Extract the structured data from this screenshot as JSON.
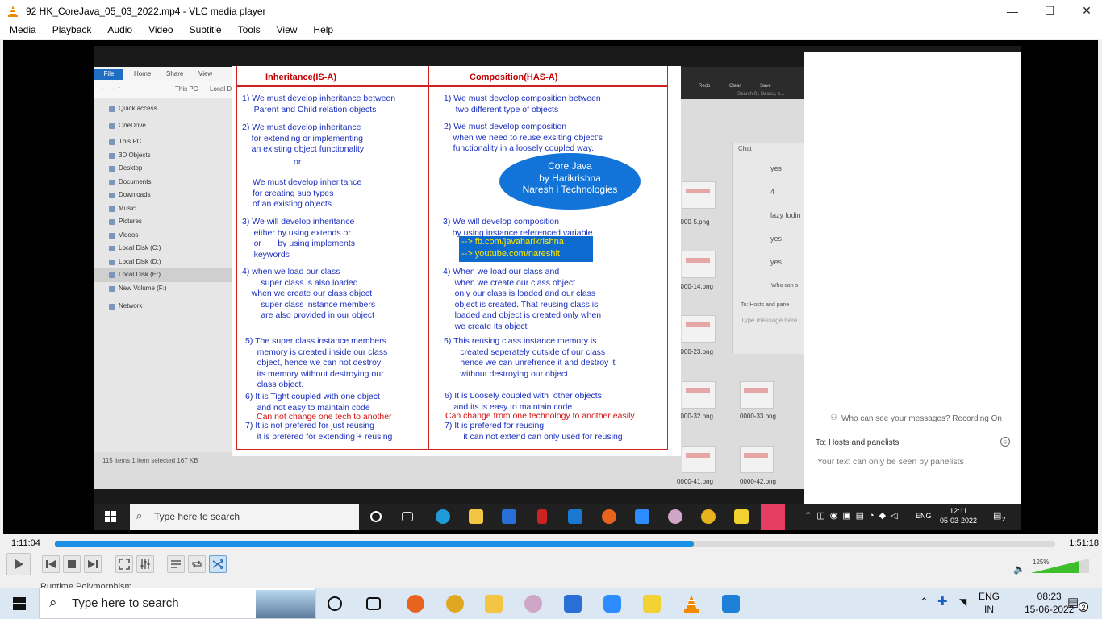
{
  "window": {
    "title": "92 HK_CoreJava_05_03_2022.mp4 - VLC media player",
    "minimize": "—",
    "maximize": "☐",
    "close": "✕"
  },
  "menu": [
    "Media",
    "Playback",
    "Audio",
    "Video",
    "Subtitle",
    "Tools",
    "View",
    "Help"
  ],
  "explorer": {
    "ribbon_tabs": [
      "File",
      "Home",
      "Share",
      "View"
    ],
    "path": [
      "This PC",
      "Local Di"
    ],
    "sidebar": [
      "Quick access",
      "OneDrive",
      "This PC",
      "3D Objects",
      "Desktop",
      "Documents",
      "Downloads",
      "Music",
      "Pictures",
      "Videos",
      "Local Disk (C:)",
      "Local Disk (D:)",
      "Local Disk (E:)",
      "New Volume (F:)",
      "Network"
    ],
    "status": "115 items    1 item selected  167 KB",
    "thumb_labels": [
      "0000-5.png",
      "0000-14.png",
      "0000-23.png",
      "0000-32.png",
      "0000-33.png",
      "0000-41.png",
      "0000-42.png"
    ],
    "search_placeholder": "Search 01 Basics, e...",
    "toolbar": [
      "Redo",
      "Clear",
      "Save"
    ]
  },
  "zoom_inner_chat": {
    "title": "Chat",
    "messages": [
      "yes",
      "4",
      "lazy lodin",
      "yes",
      "yes"
    ],
    "who": "Who can s",
    "to": "To:   Hosts and pane",
    "placeholder": "Type message here"
  },
  "slide": {
    "left_header": "Inheritance(IS-A)",
    "right_header": "Composition(HAS-A)",
    "left_points": [
      "1) We must develop inheritance between\n     Parent and Child relation objects",
      "2) We must develop inheritance\n    for extending or implementing\n    an existing object functionality",
      "or",
      "We must develop inheritance\nfor creating sub types\nof an existing objects.",
      "3) We will develop inheritance\n     either by using extends or\n     or       by using implements\n     keywords",
      "4) when we load our class\n        super class is also loaded\n    when we create our class object\n        super class instance members\n        are also provided in our object",
      "5) The super class instance members\n     memory is created inside our class\n     object, hence we can not destroy\n     its memory without destroying our\n     class object.",
      "6) It is Tight coupled with one object\n     and not easy to maintain code",
      "Can not change one tech to another",
      "7) It is not prefered for just reusing\n     it is prefered for extending + reusing"
    ],
    "right_points": [
      "1) We must develop composition between\n     two different type of objects",
      "2) We must develop composition\n    when we need to reuse exsiting object's\n    functionality in a loosely coupled way.",
      "3) We will develop composition\n    by using instance referenced variable",
      "4) When we load our class and\n     when we create our class object\n     only our class is loaded and our class\n     object is created. That reusing class is\n     loaded and object is created only when\n     we create its object",
      "5) This reusing class instance memory is\n       created seperately outside of our class\n       hence we can unrefrence it and destroy it\n       without destroying our object",
      "6) It is Loosely coupled with  other objects\n    and its is easy to maintain code",
      "Can change from one technology to another easily",
      "7) It is prefered for reusing\n        it can not extend can only used for reusing"
    ],
    "oval": [
      "Core Java",
      "by Harikrishna",
      "Naresh i Technologies"
    ],
    "links": [
      "--> fb.com/javaharikrishna",
      "--> youtube.com/nareshit"
    ]
  },
  "zoom_panel": {
    "who": "Who can see your messages? Recording On",
    "to": "To:  Hosts and panelists",
    "placeholder": "Your text can only be seen by panelists"
  },
  "inner_taskbar": {
    "search": "Type here to search",
    "lang": "ENG",
    "time": "12:11",
    "date": "05-03-2022",
    "notif": "2"
  },
  "player": {
    "elapsed": "1:11:04",
    "total": "1:51:18",
    "progress_fraction": 0.639,
    "volume": "125%",
    "volume_fraction": 0.82
  },
  "peek_text": "Runtime Polymorphism ...",
  "taskbar": {
    "search": "Type here to search",
    "lang1": "ENG",
    "lang2": "IN",
    "time": "08:23",
    "date": "15-06-2022",
    "notif": "2"
  }
}
